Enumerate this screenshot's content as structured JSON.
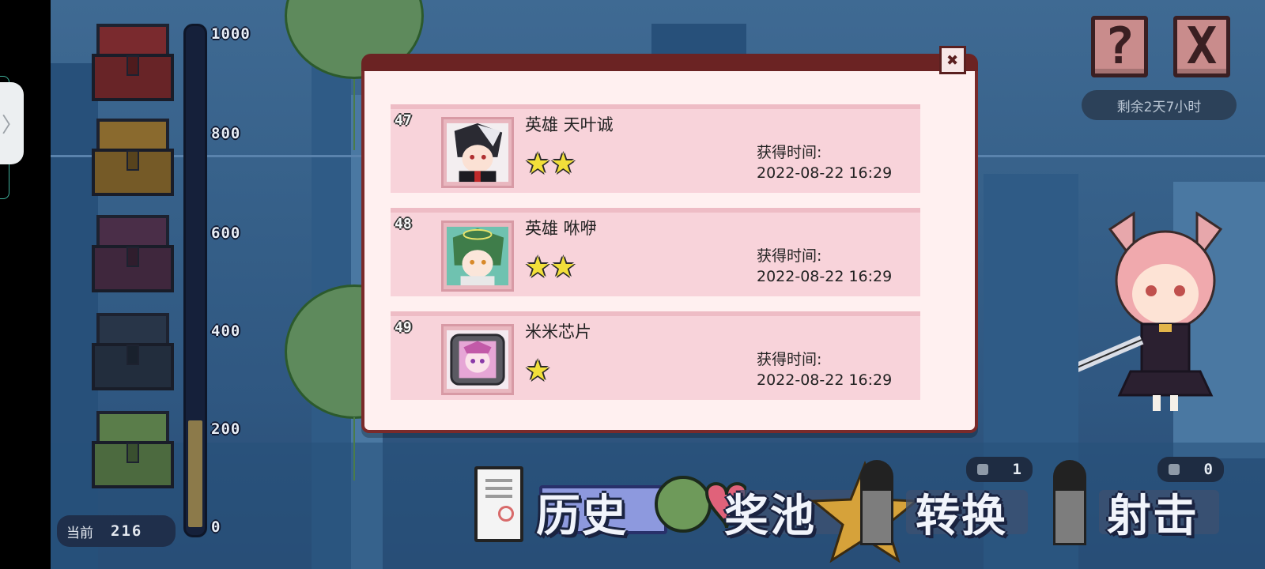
{
  "side_handle": {
    "glyph": "〉"
  },
  "gauge": {
    "scale_labels": [
      "1000",
      "800",
      "600",
      "400",
      "200",
      "0"
    ],
    "max": 1000,
    "current_label": "当前",
    "current_value": "216",
    "current_fraction": 0.216,
    "chest_colors": [
      "#7a2a2e",
      "#8a6a2e",
      "#4a2e48",
      "#283548",
      "#5a7d4a"
    ]
  },
  "top_right": {
    "help_label": "?",
    "close_label": "X",
    "timer_text": "剩余2天7小时"
  },
  "counters": [
    {
      "icon": "gem-icon",
      "value": "1"
    },
    {
      "icon": "bullet-icon",
      "value": "0"
    }
  ],
  "actions": {
    "history_label": "历史",
    "pool_label": "奖池",
    "convert_label": "转换",
    "shoot_label": "射击"
  },
  "modal": {
    "close_glyph": "✖",
    "time_label": "获得时间:",
    "entries": [
      {
        "index": "47",
        "name": "英雄 天叶诚",
        "stars": "★★",
        "star_count": 2,
        "time": "2022-08-22 16:29",
        "portrait": "hero-tianye-cheng-portrait"
      },
      {
        "index": "48",
        "name": "英雄 咻咿",
        "stars": "★★",
        "star_count": 2,
        "time": "2022-08-22 16:29",
        "portrait": "hero-xiuyi-portrait"
      },
      {
        "index": "49",
        "name": "米米芯片",
        "stars": "★",
        "star_count": 1,
        "time": "2022-08-22 16:29",
        "portrait": "mimi-chip-portrait"
      }
    ]
  }
}
